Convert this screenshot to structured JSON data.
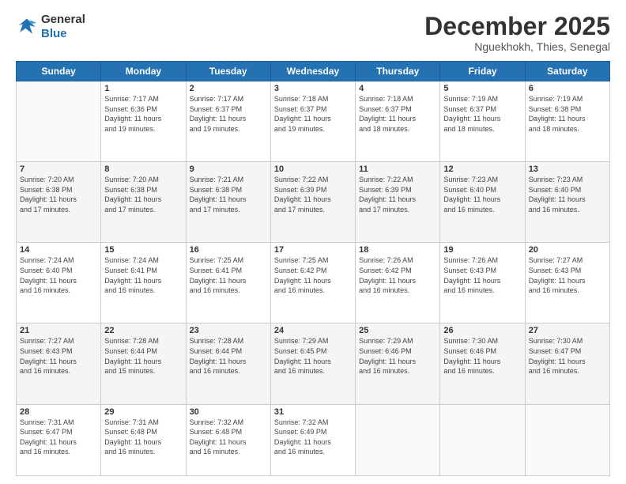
{
  "logo": {
    "line1": "General",
    "line2": "Blue"
  },
  "header": {
    "month": "December 2025",
    "location": "Nguekhokh, Thies, Senegal"
  },
  "days_of_week": [
    "Sunday",
    "Monday",
    "Tuesday",
    "Wednesday",
    "Thursday",
    "Friday",
    "Saturday"
  ],
  "weeks": [
    [
      {
        "num": "",
        "info": ""
      },
      {
        "num": "1",
        "info": "Sunrise: 7:17 AM\nSunset: 6:36 PM\nDaylight: 11 hours\nand 19 minutes."
      },
      {
        "num": "2",
        "info": "Sunrise: 7:17 AM\nSunset: 6:37 PM\nDaylight: 11 hours\nand 19 minutes."
      },
      {
        "num": "3",
        "info": "Sunrise: 7:18 AM\nSunset: 6:37 PM\nDaylight: 11 hours\nand 19 minutes."
      },
      {
        "num": "4",
        "info": "Sunrise: 7:18 AM\nSunset: 6:37 PM\nDaylight: 11 hours\nand 18 minutes."
      },
      {
        "num": "5",
        "info": "Sunrise: 7:19 AM\nSunset: 6:37 PM\nDaylight: 11 hours\nand 18 minutes."
      },
      {
        "num": "6",
        "info": "Sunrise: 7:19 AM\nSunset: 6:38 PM\nDaylight: 11 hours\nand 18 minutes."
      }
    ],
    [
      {
        "num": "7",
        "info": "Sunrise: 7:20 AM\nSunset: 6:38 PM\nDaylight: 11 hours\nand 17 minutes."
      },
      {
        "num": "8",
        "info": "Sunrise: 7:20 AM\nSunset: 6:38 PM\nDaylight: 11 hours\nand 17 minutes."
      },
      {
        "num": "9",
        "info": "Sunrise: 7:21 AM\nSunset: 6:38 PM\nDaylight: 11 hours\nand 17 minutes."
      },
      {
        "num": "10",
        "info": "Sunrise: 7:22 AM\nSunset: 6:39 PM\nDaylight: 11 hours\nand 17 minutes."
      },
      {
        "num": "11",
        "info": "Sunrise: 7:22 AM\nSunset: 6:39 PM\nDaylight: 11 hours\nand 17 minutes."
      },
      {
        "num": "12",
        "info": "Sunrise: 7:23 AM\nSunset: 6:40 PM\nDaylight: 11 hours\nand 16 minutes."
      },
      {
        "num": "13",
        "info": "Sunrise: 7:23 AM\nSunset: 6:40 PM\nDaylight: 11 hours\nand 16 minutes."
      }
    ],
    [
      {
        "num": "14",
        "info": "Sunrise: 7:24 AM\nSunset: 6:40 PM\nDaylight: 11 hours\nand 16 minutes."
      },
      {
        "num": "15",
        "info": "Sunrise: 7:24 AM\nSunset: 6:41 PM\nDaylight: 11 hours\nand 16 minutes."
      },
      {
        "num": "16",
        "info": "Sunrise: 7:25 AM\nSunset: 6:41 PM\nDaylight: 11 hours\nand 16 minutes."
      },
      {
        "num": "17",
        "info": "Sunrise: 7:25 AM\nSunset: 6:42 PM\nDaylight: 11 hours\nand 16 minutes."
      },
      {
        "num": "18",
        "info": "Sunrise: 7:26 AM\nSunset: 6:42 PM\nDaylight: 11 hours\nand 16 minutes."
      },
      {
        "num": "19",
        "info": "Sunrise: 7:26 AM\nSunset: 6:43 PM\nDaylight: 11 hours\nand 16 minutes."
      },
      {
        "num": "20",
        "info": "Sunrise: 7:27 AM\nSunset: 6:43 PM\nDaylight: 11 hours\nand 16 minutes."
      }
    ],
    [
      {
        "num": "21",
        "info": "Sunrise: 7:27 AM\nSunset: 6:43 PM\nDaylight: 11 hours\nand 16 minutes."
      },
      {
        "num": "22",
        "info": "Sunrise: 7:28 AM\nSunset: 6:44 PM\nDaylight: 11 hours\nand 15 minutes."
      },
      {
        "num": "23",
        "info": "Sunrise: 7:28 AM\nSunset: 6:44 PM\nDaylight: 11 hours\nand 16 minutes."
      },
      {
        "num": "24",
        "info": "Sunrise: 7:29 AM\nSunset: 6:45 PM\nDaylight: 11 hours\nand 16 minutes."
      },
      {
        "num": "25",
        "info": "Sunrise: 7:29 AM\nSunset: 6:46 PM\nDaylight: 11 hours\nand 16 minutes."
      },
      {
        "num": "26",
        "info": "Sunrise: 7:30 AM\nSunset: 6:46 PM\nDaylight: 11 hours\nand 16 minutes."
      },
      {
        "num": "27",
        "info": "Sunrise: 7:30 AM\nSunset: 6:47 PM\nDaylight: 11 hours\nand 16 minutes."
      }
    ],
    [
      {
        "num": "28",
        "info": "Sunrise: 7:31 AM\nSunset: 6:47 PM\nDaylight: 11 hours\nand 16 minutes."
      },
      {
        "num": "29",
        "info": "Sunrise: 7:31 AM\nSunset: 6:48 PM\nDaylight: 11 hours\nand 16 minutes."
      },
      {
        "num": "30",
        "info": "Sunrise: 7:32 AM\nSunset: 6:48 PM\nDaylight: 11 hours\nand 16 minutes."
      },
      {
        "num": "31",
        "info": "Sunrise: 7:32 AM\nSunset: 6:49 PM\nDaylight: 11 hours\nand 16 minutes."
      },
      {
        "num": "",
        "info": ""
      },
      {
        "num": "",
        "info": ""
      },
      {
        "num": "",
        "info": ""
      }
    ]
  ]
}
